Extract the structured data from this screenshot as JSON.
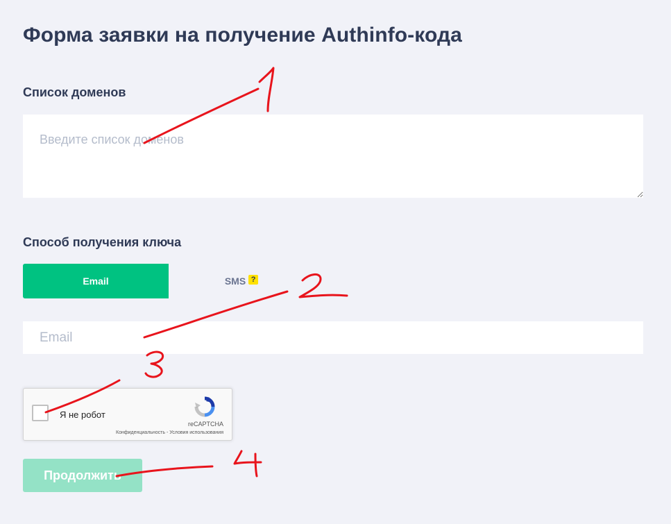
{
  "page": {
    "title": "Форма заявки на получение Authinfo-кода"
  },
  "domains": {
    "label": "Список доменов",
    "placeholder": "Введите список доменов",
    "value": ""
  },
  "delivery": {
    "label": "Способ получения ключа",
    "tabs": [
      {
        "label": "Email",
        "selected": true
      },
      {
        "label": "SMS",
        "selected": false,
        "help": "?"
      }
    ],
    "email_placeholder": "Email",
    "email_value": ""
  },
  "recaptcha": {
    "checkbox_label": "Я не робот",
    "brand": "reCAPTCHA",
    "privacy_link": "Конфиденциальность",
    "separator": "-",
    "terms_link": "Условия использования",
    "checked": false
  },
  "submit": {
    "label": "Продолжить",
    "enabled": false
  },
  "annotations": {
    "marker_color": "#e8141c",
    "items": [
      "1",
      "2",
      "3",
      "4"
    ]
  },
  "colors": {
    "background": "#f1f2f8",
    "accent": "#00c281",
    "accent_disabled": "#94e2c6",
    "help_badge": "#ffe100",
    "heading": "#2f3a56"
  }
}
